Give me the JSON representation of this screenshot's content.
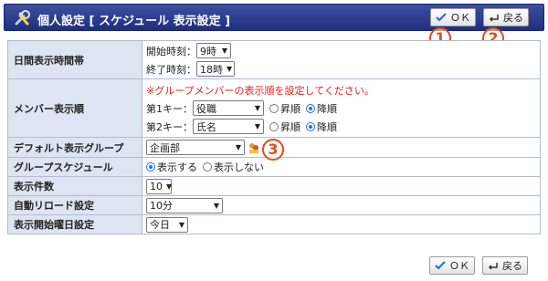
{
  "header": {
    "title": "個人設定 [ スケジュール  表示設定 ]"
  },
  "buttons": {
    "ok": "ＯＫ",
    "back": "戻る"
  },
  "badges": [
    "1",
    "2",
    "3"
  ],
  "rows": {
    "daily_hours": {
      "label": "日間表示時間帯",
      "start_label": "開始時刻：",
      "start_value": "9時",
      "end_label": "終了時刻：",
      "end_value": "18時"
    },
    "member_order": {
      "label": "メンバー表示順",
      "notice": "※グループメンバーの表示順を設定してください。",
      "key1_label": "第1キー：",
      "key1_value": "役職",
      "key2_label": "第2キー：",
      "key2_value": "氏名",
      "asc": "昇順",
      "desc": "降順",
      "key1_selected": "降順",
      "key2_selected": "降順"
    },
    "default_group": {
      "label": "デフォルト表示グループ",
      "value": "企画部"
    },
    "group_schedule": {
      "label": "グループスケジュール",
      "show": "表示する",
      "hide": "表示しない",
      "selected": "表示する"
    },
    "display_count": {
      "label": "表示件数",
      "value": "10"
    },
    "auto_reload": {
      "label": "自動リロード設定",
      "value": "10分"
    },
    "week_start": {
      "label": "表示開始曜日設定",
      "value": "今日"
    }
  },
  "colors": {
    "header_bg": "#2a3a8c",
    "label_bg": "#dde4f2",
    "badge": "#e54c13",
    "notice": "#e0201d"
  }
}
